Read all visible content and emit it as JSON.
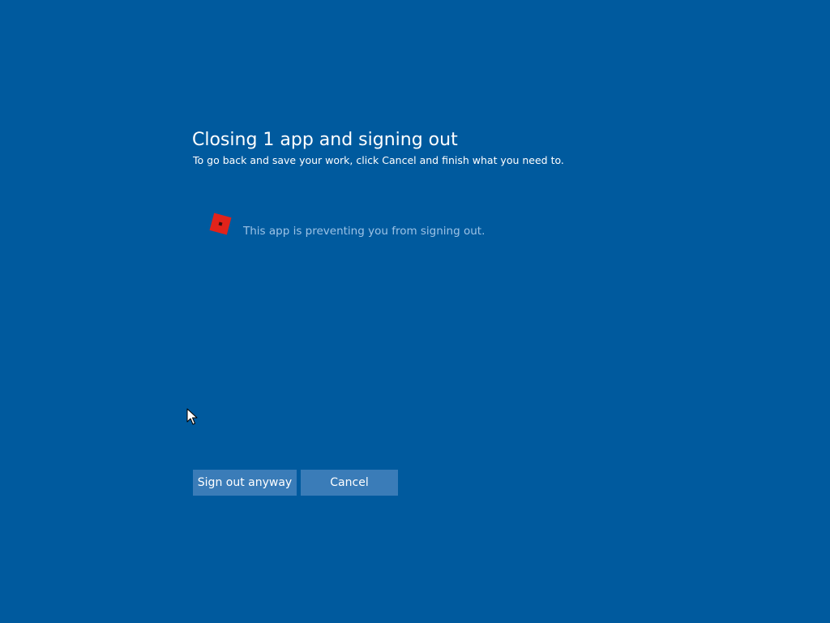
{
  "dialog": {
    "title": "Closing 1 app and signing out",
    "subtitle": "To go back and save your work, click Cancel and finish what you need to.",
    "app": {
      "icon": "roblox-app-icon",
      "message": "This app is preventing you from signing out."
    },
    "buttons": {
      "sign_out_label": "Sign out anyway",
      "cancel_label": "Cancel"
    }
  },
  "colors": {
    "background": "#005a9e",
    "button": "#3a7cb8",
    "message_text": "#9dc3e6",
    "app_icon": "#e2231a"
  },
  "cursor": {
    "icon": "mouse-pointer-icon"
  }
}
